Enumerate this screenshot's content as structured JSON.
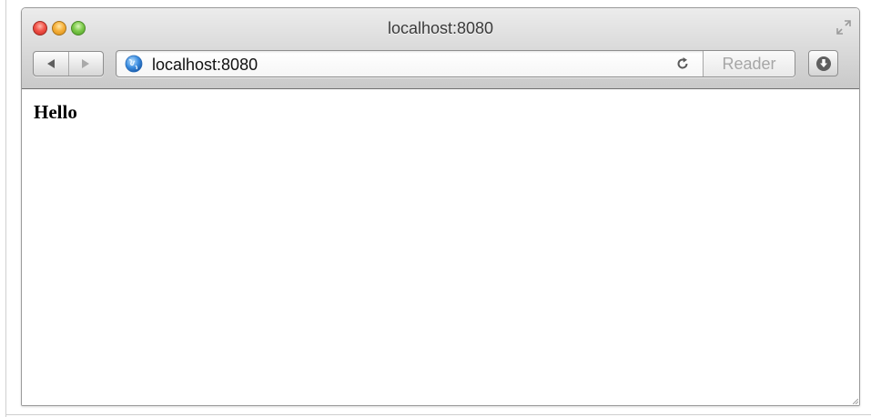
{
  "window": {
    "title": "localhost:8080"
  },
  "toolbar": {
    "back_icon": "back-arrow-icon",
    "forward_icon": "forward-arrow-icon",
    "reload_icon": "reload-icon",
    "reader_label": "Reader",
    "downloads_icon": "download-arrow-icon",
    "fullscreen_icon": "fullscreen-arrows-icon"
  },
  "address_bar": {
    "url": "localhost:8080",
    "site_icon": "globe-icon"
  },
  "page": {
    "heading": "Hello"
  },
  "colors": {
    "close": "#f2544a",
    "minimize": "#f6b13c",
    "zoom": "#7ecb4c",
    "reader_disabled_text": "#a6a6a6",
    "globe_blue": "#3b8de0"
  }
}
